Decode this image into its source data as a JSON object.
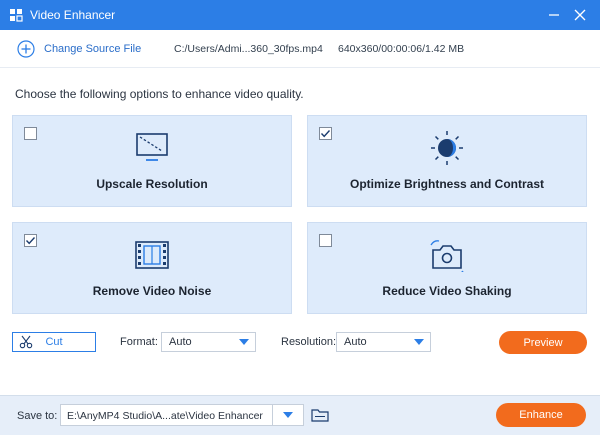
{
  "window": {
    "title": "Video Enhancer",
    "app_icon": "video-enhancer-app-icon",
    "accent_color": "#2c7ee6"
  },
  "file_bar": {
    "change_source_label": "Change Source File",
    "file_path": "C:/Users/Admi...360_30fps.mp4",
    "file_info": "640x360/00:00:06/1.42 MB"
  },
  "instruction": "Choose the following options to enhance video quality.",
  "options": [
    {
      "label": "Upscale Resolution",
      "checked": false,
      "icon": "upscale-monitor-icon"
    },
    {
      "label": "Optimize Brightness and Contrast",
      "checked": true,
      "icon": "brightness-sun-icon"
    },
    {
      "label": "Remove Video Noise",
      "checked": true,
      "icon": "film-strip-icon"
    },
    {
      "label": "Reduce Video Shaking",
      "checked": false,
      "icon": "camera-shake-icon"
    }
  ],
  "controls": {
    "cut_label": "Cut",
    "format_label": "Format:",
    "format_value": "Auto",
    "resolution_label": "Resolution:",
    "resolution_value": "Auto",
    "preview_label": "Preview"
  },
  "bottom": {
    "save_to_label": "Save to:",
    "save_path": "E:\\AnyMP4 Studio\\A...ate\\Video Enhancer",
    "enhance_label": "Enhance",
    "action_color": "#f26b1d"
  }
}
